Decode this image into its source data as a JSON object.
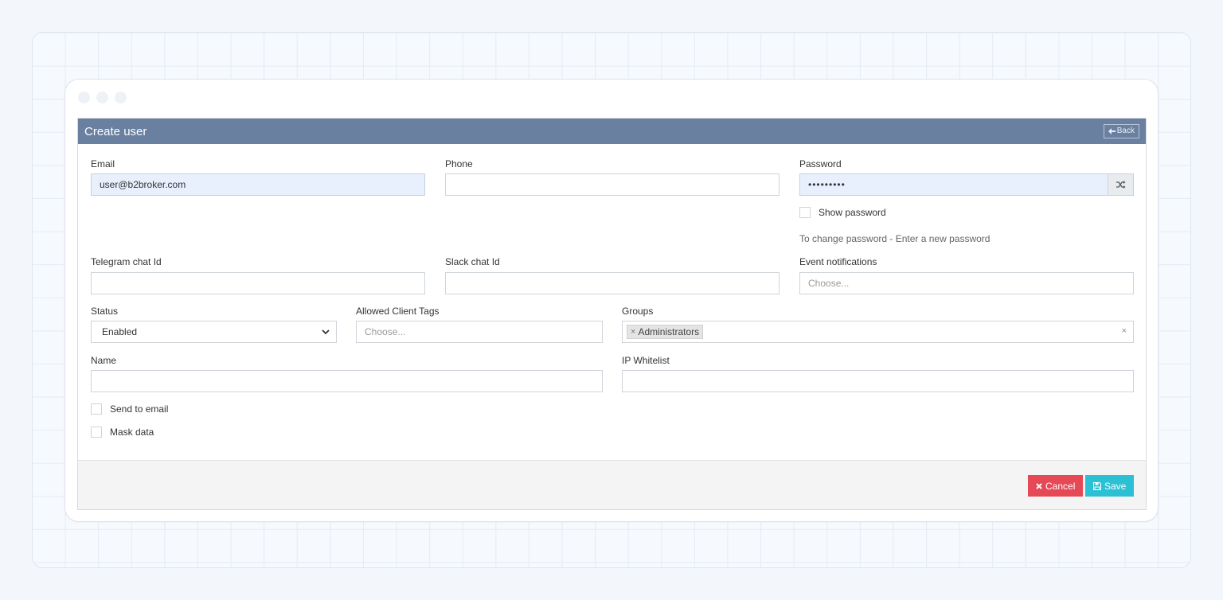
{
  "window": {
    "title": "Create user",
    "back_label": "Back"
  },
  "fields": {
    "email": {
      "label": "Email",
      "value": "user@b2broker.com"
    },
    "phone": {
      "label": "Phone",
      "value": ""
    },
    "password": {
      "label": "Password",
      "value": "•••••••••"
    },
    "show_password": {
      "label": "Show password",
      "checked": false
    },
    "password_hint": "To change password - Enter a new password",
    "telegram": {
      "label": "Telegram chat Id",
      "value": ""
    },
    "slack": {
      "label": "Slack chat Id",
      "value": ""
    },
    "event_notifications": {
      "label": "Event notifications",
      "placeholder": "Choose..."
    },
    "status": {
      "label": "Status",
      "value": "Enabled"
    },
    "allowed_client_tags": {
      "label": "Allowed Client Tags",
      "placeholder": "Choose..."
    },
    "groups": {
      "label": "Groups",
      "tags": [
        "Administrators"
      ]
    },
    "name": {
      "label": "Name",
      "value": ""
    },
    "ip_whitelist": {
      "label": "IP Whitelist",
      "value": ""
    },
    "send_to_email": {
      "label": "Send to email",
      "checked": false
    },
    "mask_data": {
      "label": "Mask data",
      "checked": false
    }
  },
  "footer": {
    "cancel_label": "Cancel",
    "save_label": "Save"
  },
  "icons": {
    "back": "arrow-left-icon",
    "shuffle": "shuffle-icon",
    "select": "chevron-down-icon",
    "tag_remove": "close-icon",
    "clear": "close-icon",
    "cancel": "close-icon",
    "save": "floppy-disk-icon"
  },
  "colors": {
    "header": "#6a80a0",
    "cancel": "#e54955",
    "save": "#2bc0d3",
    "filled_input": "#e8f0fe"
  }
}
